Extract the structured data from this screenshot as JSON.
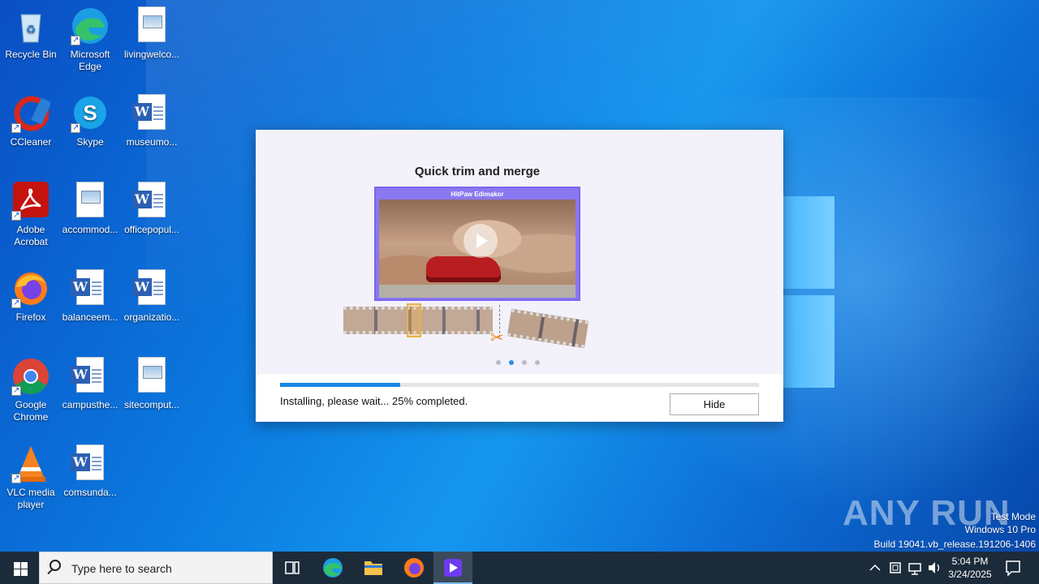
{
  "desktop": {
    "icons": [
      {
        "label": "Recycle Bin"
      },
      {
        "label": "Microsoft Edge"
      },
      {
        "label": "livingwelco..."
      },
      {
        "label": "CCleaner"
      },
      {
        "label": "Skype"
      },
      {
        "label": "museumo..."
      },
      {
        "label": "Adobe Acrobat"
      },
      {
        "label": "accommod..."
      },
      {
        "label": "officepopul..."
      },
      {
        "label": "Firefox"
      },
      {
        "label": "balanceem..."
      },
      {
        "label": "organizatio..."
      },
      {
        "label": "Google Chrome"
      },
      {
        "label": "campusthe..."
      },
      {
        "label": "sitecomput..."
      },
      {
        "label": "VLC media player"
      },
      {
        "label": "comsunda..."
      }
    ]
  },
  "installer": {
    "title": "Quick trim and merge",
    "preview_brand": "HitPaw Edimakor",
    "progress_percent": 25,
    "status": "Installing, please wait... 25% completed.",
    "hide_label": "Hide",
    "carousel_active_index": 1,
    "carousel_count": 4
  },
  "watermark": {
    "logo": "ANY RUN",
    "line1": "Test Mode",
    "line2": "Windows 10 Pro",
    "line3": "Build 19041.vb_release.191206-1406"
  },
  "taskbar": {
    "search_placeholder": "Type here to search",
    "time": "5:04 PM",
    "date": "3/24/2025"
  },
  "colors": {
    "accent": "#1c86e4",
    "installer_purple": "#7b66ee",
    "taskbar": "#1c2b3a"
  }
}
